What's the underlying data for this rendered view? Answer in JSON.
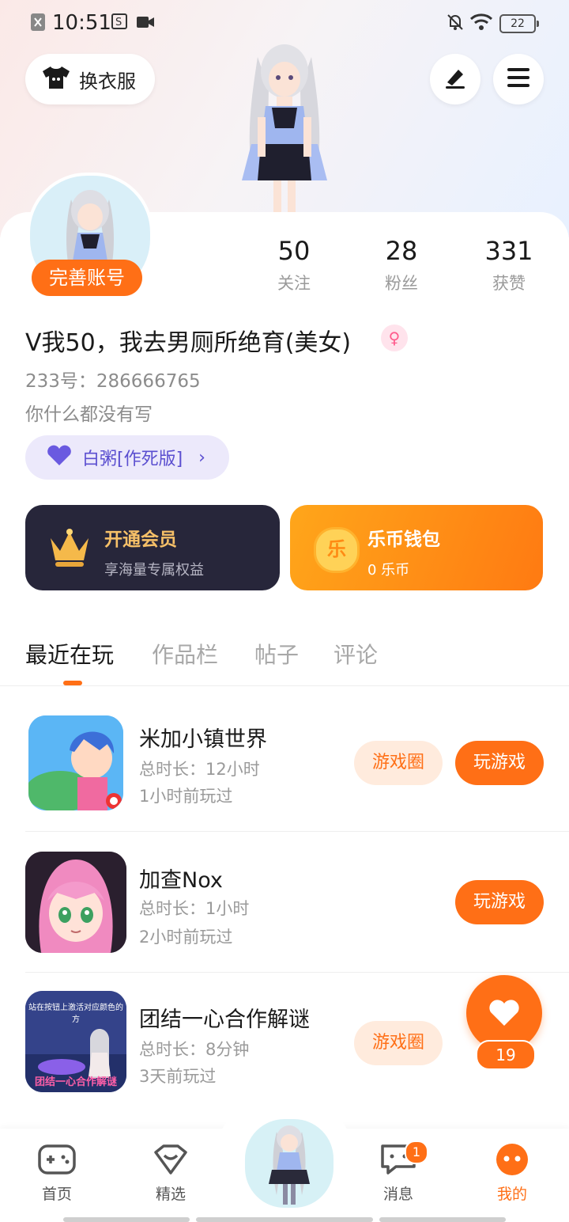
{
  "status_bar": {
    "time": "10:51",
    "battery": "22"
  },
  "header": {
    "outfit_label": "换衣服"
  },
  "profile": {
    "complete_label": "完善账号",
    "stats": [
      {
        "value": "50",
        "label": "关注"
      },
      {
        "value": "28",
        "label": "粉丝"
      },
      {
        "value": "331",
        "label": "获赞"
      }
    ],
    "username": "V我50，我去男厕所绝育(美女)",
    "gender_icon": "female-symbol-icon",
    "uid": "233号：286666765",
    "bio": "你什么都没有写",
    "title_badge": "白粥[作死版]"
  },
  "features": {
    "vip": {
      "title": "开通会员",
      "subtitle": "享海量专属权益"
    },
    "wallet": {
      "title": "乐币钱包",
      "subtitle": "0 乐币",
      "coin_glyph": "乐"
    }
  },
  "tabs": [
    "最近在玩",
    "作品栏",
    "帖子",
    "评论"
  ],
  "games": [
    {
      "name": "米加小镇世界",
      "duration": "总时长：12小时",
      "last_played": "1小时前玩过",
      "circle_label": "游戏圈",
      "play_label": "玩游戏"
    },
    {
      "name": "加查Nox",
      "duration": "总时长：1小时",
      "last_played": "2小时前玩过",
      "circle_label": "",
      "play_label": "玩游戏"
    },
    {
      "name": "团结一心合作解谜",
      "duration": "总时长：8分钟",
      "last_played": "3天前玩过",
      "circle_label": "游戏圈",
      "play_label": "",
      "icon_text_top": "站在按钮上激活对应颜色的方",
      "icon_text_bottom": "团结一心合作解谜"
    }
  ],
  "like_count": "19",
  "bottom_nav": [
    {
      "label": "首页",
      "icon": "gamepad-icon"
    },
    {
      "label": "精选",
      "icon": "heart-outline-icon"
    },
    {
      "label": "",
      "icon": "avatar-center"
    },
    {
      "label": "消息",
      "icon": "chat-icon",
      "badge": "1"
    },
    {
      "label": "我的",
      "icon": "profile-face-icon"
    }
  ],
  "colors": {
    "accent": "#ff6f16",
    "vip_bg": "#27263a",
    "title_badge": "#5b4fd0"
  }
}
